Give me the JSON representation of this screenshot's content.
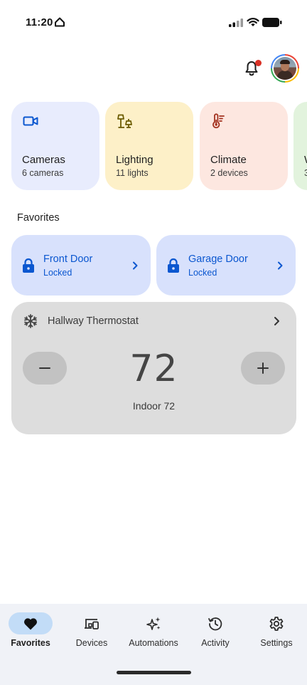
{
  "status_bar": {
    "time": "11:20"
  },
  "header": {
    "notification_badge": true
  },
  "categories": [
    {
      "title": "Cameras",
      "subtitle": "6 cameras",
      "icon": "videocam-icon",
      "color": "#e8ecfd"
    },
    {
      "title": "Lighting",
      "subtitle": "11 lights",
      "icon": "lamp-icon",
      "color": "#fdf0c8"
    },
    {
      "title": "Climate",
      "subtitle": "2 devices",
      "icon": "thermometer-icon",
      "color": "#fde7e0"
    },
    {
      "title": "W",
      "subtitle": "3",
      "icon": "",
      "color": "#e2f3dd"
    }
  ],
  "favorites": {
    "title": "Favorites",
    "locks": [
      {
        "name": "Front Door",
        "state": "Locked"
      },
      {
        "name": "Garage Door",
        "state": "Locked"
      }
    ],
    "thermostat": {
      "name": "Hallway Thermostat",
      "setpoint": "72",
      "indoor": "Indoor 72",
      "mode_icon": "snowflake-icon"
    }
  },
  "nav": [
    {
      "label": "Favorites",
      "icon": "heart-icon",
      "active": true
    },
    {
      "label": "Devices",
      "icon": "devices-icon",
      "active": false
    },
    {
      "label": "Automations",
      "icon": "sparkle-icon",
      "active": false
    },
    {
      "label": "Activity",
      "icon": "history-icon",
      "active": false
    },
    {
      "label": "Settings",
      "icon": "gear-icon",
      "active": false
    }
  ],
  "colors": {
    "accent": "#0b57d0",
    "lock_card": "#d8e1fc",
    "thermostat_card": "#dddddd",
    "nav_active_pill": "#c2dcf7"
  }
}
